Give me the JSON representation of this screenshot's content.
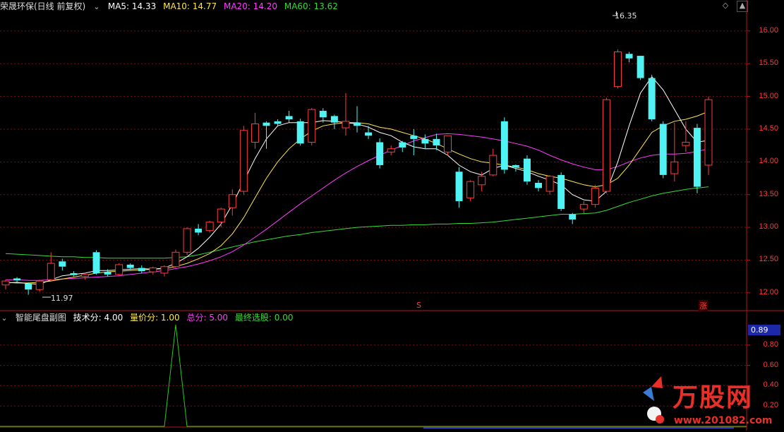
{
  "main_header": {
    "title": "荣晟环保(日线 前复权)",
    "ma5_label": "MA5: 14.33",
    "ma10_label": "MA10: 14.77",
    "ma20_label": "MA20: 14.20",
    "ma60_label": "MA60: 13.62"
  },
  "sub_header": {
    "title": "智能尾盘副图",
    "tech_label": "技术分: 4.00",
    "vol_label": "量价分: 1.00",
    "total_label": "总分: 5.00",
    "final_label": "最终选股: 0.00"
  },
  "colors": {
    "up": "#ff3b3b",
    "down": "#4ff3f3",
    "ma5": "#ffffff",
    "ma10": "#ffe84a",
    "ma20": "#ff3cff",
    "ma60": "#33dd33",
    "grid": "#7a1010",
    "sub_line": "#22cc22"
  },
  "annotations": {
    "high_label": "16.35",
    "low_label": "11.97",
    "marker_s": "S",
    "marker_zhang": "涨"
  },
  "price_axis": [
    "16.00",
    "15.50",
    "15.00",
    "14.50",
    "14.00",
    "13.50",
    "13.00",
    "12.50",
    "12.00"
  ],
  "sub_axis": [
    "0.89",
    "0.80",
    "0.60",
    "0.40",
    "0.20"
  ],
  "sub_value_tag": "0.89",
  "watermark": {
    "brand": "万股网",
    "url": "www.201082.com"
  },
  "icons": [
    "dropdown-icon",
    "diamond-icon",
    "scroll-up-icon"
  ],
  "chart_data": [
    {
      "type": "candlestick",
      "title": "荣晟环保(日线 前复权)",
      "ylim": [
        11.75,
        16.3
      ],
      "candles": [
        [
          12.12,
          12.2,
          12.05,
          12.18
        ],
        [
          12.22,
          12.24,
          12.15,
          12.19
        ],
        [
          12.14,
          12.16,
          11.97,
          12.05
        ],
        [
          12.05,
          12.2,
          12.02,
          12.18
        ],
        [
          12.2,
          12.62,
          12.18,
          12.45
        ],
        [
          12.48,
          12.52,
          12.34,
          12.4
        ],
        [
          12.3,
          12.33,
          12.25,
          12.27
        ],
        [
          12.25,
          12.3,
          12.2,
          12.28
        ],
        [
          12.62,
          12.65,
          12.28,
          12.3
        ],
        [
          12.32,
          12.36,
          12.25,
          12.28
        ],
        [
          12.28,
          12.45,
          12.25,
          12.43
        ],
        [
          12.43,
          12.45,
          12.35,
          12.38
        ],
        [
          12.38,
          12.42,
          12.3,
          12.33
        ],
        [
          12.32,
          12.4,
          12.28,
          12.38
        ],
        [
          12.3,
          12.42,
          12.25,
          12.4
        ],
        [
          12.4,
          12.66,
          12.38,
          12.62
        ],
        [
          12.62,
          13.0,
          12.58,
          12.98
        ],
        [
          12.98,
          13.05,
          12.88,
          12.92
        ],
        [
          12.95,
          13.1,
          12.92,
          13.08
        ],
        [
          13.08,
          13.3,
          13.0,
          13.28
        ],
        [
          13.3,
          13.58,
          13.18,
          13.5
        ],
        [
          13.55,
          14.55,
          13.5,
          14.48
        ],
        [
          14.3,
          14.75,
          14.2,
          14.58
        ],
        [
          14.6,
          14.62,
          14.2,
          14.55
        ],
        [
          14.62,
          14.65,
          14.55,
          14.58
        ],
        [
          14.7,
          14.78,
          14.6,
          14.65
        ],
        [
          14.62,
          14.66,
          14.25,
          14.28
        ],
        [
          14.3,
          14.82,
          14.25,
          14.8
        ],
        [
          14.78,
          14.82,
          14.6,
          14.68
        ],
        [
          14.7,
          14.72,
          14.5,
          14.6
        ],
        [
          14.52,
          15.05,
          14.4,
          14.62
        ],
        [
          14.6,
          14.85,
          14.45,
          14.55
        ],
        [
          14.45,
          14.55,
          14.35,
          14.4
        ],
        [
          14.3,
          14.36,
          13.9,
          13.95
        ],
        [
          14.15,
          14.25,
          14.1,
          14.2
        ],
        [
          14.3,
          14.32,
          14.15,
          14.22
        ],
        [
          14.4,
          14.5,
          14.1,
          14.35
        ],
        [
          14.35,
          14.42,
          14.2,
          14.28
        ],
        [
          14.35,
          14.43,
          14.18,
          14.25
        ],
        [
          14.15,
          14.3,
          14.1,
          14.4
        ],
        [
          13.85,
          13.92,
          13.3,
          13.4
        ],
        [
          13.45,
          13.72,
          13.4,
          13.7
        ],
        [
          13.65,
          13.85,
          13.55,
          13.78
        ],
        [
          13.8,
          14.2,
          13.78,
          14.1
        ],
        [
          14.62,
          14.68,
          13.82,
          13.88
        ],
        [
          13.95,
          13.96,
          13.85,
          13.92
        ],
        [
          14.05,
          14.1,
          13.65,
          13.7
        ],
        [
          13.68,
          13.72,
          13.55,
          13.6
        ],
        [
          13.55,
          13.8,
          13.5,
          13.78
        ],
        [
          13.8,
          13.84,
          13.25,
          13.28
        ],
        [
          13.2,
          13.22,
          13.05,
          13.12
        ],
        [
          13.28,
          13.4,
          13.2,
          13.35
        ],
        [
          13.35,
          13.65,
          13.3,
          13.6
        ],
        [
          13.55,
          14.98,
          13.52,
          14.95
        ],
        [
          15.15,
          15.72,
          15.12,
          15.68
        ],
        [
          15.65,
          15.68,
          15.52,
          15.58
        ],
        [
          15.62,
          15.62,
          15.25,
          15.28
        ],
        [
          15.28,
          15.33,
          14.62,
          14.65
        ],
        [
          14.58,
          14.62,
          13.75,
          13.8
        ],
        [
          13.82,
          14.6,
          13.7,
          14.0
        ],
        [
          14.25,
          14.62,
          14.15,
          14.3
        ],
        [
          14.52,
          14.58,
          13.52,
          13.62
        ],
        [
          13.95,
          15.0,
          13.8,
          14.95
        ]
      ],
      "ma5": [
        12.15,
        12.16,
        12.14,
        12.13,
        12.2,
        12.26,
        12.28,
        12.3,
        12.34,
        12.34,
        12.35,
        12.36,
        12.37,
        12.36,
        12.38,
        12.45,
        12.55,
        12.68,
        12.85,
        13.05,
        13.35,
        13.7,
        14.05,
        14.35,
        14.55,
        14.6,
        14.6,
        14.6,
        14.63,
        14.62,
        14.6,
        14.58,
        14.53,
        14.45,
        14.4,
        14.3,
        14.23,
        14.2,
        14.2,
        14.1,
        13.95,
        13.85,
        13.8,
        13.9,
        13.95,
        13.9,
        13.85,
        13.78,
        13.72,
        13.65,
        13.5,
        13.42,
        13.4,
        13.55,
        14.0,
        14.55,
        15.05,
        15.3,
        15.1,
        14.8,
        14.5,
        14.3,
        14.33
      ],
      "ma10": [
        12.16,
        12.15,
        12.15,
        12.16,
        12.18,
        12.21,
        12.24,
        12.27,
        12.3,
        12.32,
        12.33,
        12.34,
        12.35,
        12.36,
        12.37,
        12.4,
        12.45,
        12.52,
        12.6,
        12.72,
        12.9,
        13.15,
        13.45,
        13.75,
        14.0,
        14.2,
        14.35,
        14.47,
        14.55,
        14.58,
        14.6,
        14.6,
        14.58,
        14.53,
        14.5,
        14.45,
        14.4,
        14.35,
        14.28,
        14.2,
        14.12,
        14.05,
        14.0,
        13.98,
        13.95,
        13.92,
        13.88,
        13.82,
        13.78,
        13.75,
        13.7,
        13.65,
        13.62,
        13.65,
        13.75,
        13.95,
        14.2,
        14.45,
        14.55,
        14.62,
        14.65,
        14.7,
        14.77
      ],
      "ma20": [
        12.2,
        12.2,
        12.19,
        12.19,
        12.2,
        12.21,
        12.22,
        12.23,
        12.24,
        12.25,
        12.26,
        12.28,
        12.3,
        12.32,
        12.34,
        12.37,
        12.4,
        12.44,
        12.49,
        12.55,
        12.63,
        12.73,
        12.85,
        12.97,
        13.1,
        13.23,
        13.36,
        13.48,
        13.6,
        13.72,
        13.83,
        13.93,
        14.02,
        14.1,
        14.18,
        14.25,
        14.32,
        14.37,
        14.42,
        14.43,
        14.42,
        14.4,
        14.38,
        14.35,
        14.32,
        14.28,
        14.24,
        14.18,
        14.1,
        14.03,
        13.97,
        13.92,
        13.88,
        13.88,
        13.93,
        14.0,
        14.06,
        14.1,
        14.12,
        14.12,
        14.13,
        14.16,
        14.2
      ],
      "ma60": [
        12.6,
        12.59,
        12.58,
        12.57,
        12.56,
        12.55,
        12.55,
        12.54,
        12.54,
        12.53,
        12.53,
        12.53,
        12.53,
        12.53,
        12.53,
        12.54,
        12.55,
        12.58,
        12.62,
        12.66,
        12.7,
        12.74,
        12.78,
        12.81,
        12.84,
        12.87,
        12.89,
        12.92,
        12.94,
        12.96,
        12.98,
        13.0,
        13.01,
        13.02,
        13.03,
        13.03,
        13.04,
        13.04,
        13.05,
        13.05,
        13.06,
        13.06,
        13.07,
        13.08,
        13.1,
        13.12,
        13.14,
        13.16,
        13.18,
        13.2,
        13.2,
        13.21,
        13.22,
        13.26,
        13.32,
        13.38,
        13.43,
        13.48,
        13.52,
        13.55,
        13.58,
        13.6,
        13.62
      ]
    },
    {
      "type": "line",
      "title": "智能尾盘副图",
      "ylim": [
        0,
        1.0
      ],
      "values": [
        0,
        0,
        0,
        0,
        0,
        0,
        0,
        0,
        0,
        0,
        0,
        0,
        0,
        0,
        0,
        1.0,
        0,
        0,
        0,
        0,
        0,
        0,
        0,
        0,
        0,
        0,
        0,
        0,
        0,
        0,
        0,
        0,
        0,
        0,
        0,
        0,
        0,
        0,
        0,
        0,
        0,
        0,
        0,
        0,
        0,
        0,
        0,
        0,
        0,
        0,
        0,
        0,
        0,
        0,
        0,
        0,
        0,
        0,
        0,
        0,
        0,
        0,
        0
      ]
    }
  ]
}
